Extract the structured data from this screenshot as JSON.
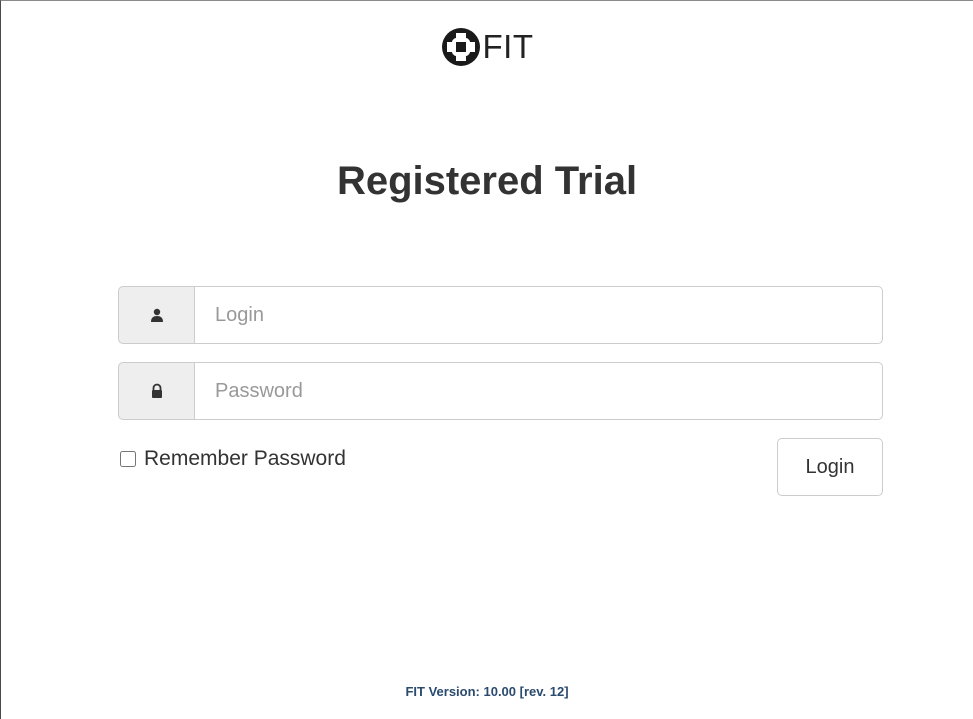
{
  "logo": {
    "icon": "puzzle-cross-icon",
    "text": "FIT"
  },
  "title": "Registered Trial",
  "form": {
    "login": {
      "icon": "user-icon",
      "placeholder": "Login",
      "value": ""
    },
    "password": {
      "icon": "lock-icon",
      "placeholder": "Password",
      "value": ""
    },
    "remember": {
      "label": "Remember Password",
      "checked": false
    },
    "submit_label": "Login"
  },
  "footer": {
    "version": "FIT Version: 10.00 [rev. 12]"
  },
  "colors": {
    "version_text": "#2a4a6e",
    "addon_bg": "#eeeeee",
    "border": "#cccccc"
  }
}
